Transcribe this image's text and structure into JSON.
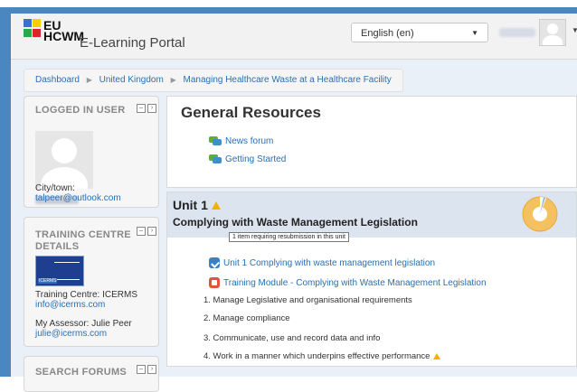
{
  "header": {
    "logo_line1": "EU",
    "logo_line2": "HCWM",
    "portal_name": "E-Learning Portal",
    "language": "English (en)",
    "colors": {
      "frame": "#4a86c0",
      "link": "#2a6fb3",
      "warning": "#f2b300"
    }
  },
  "breadcrumb": [
    "Dashboard",
    "United Kingdom",
    "Managing Healthcare Waste at a Healthcare Facility"
  ],
  "logged_user": {
    "title": "LOGGED IN USER",
    "city_label": "City/town:",
    "email": "talpeer@outlook.com"
  },
  "training_centre": {
    "title_line1": "TRAINING CENTRE",
    "title_line2": "DETAILS",
    "logo_label": "ICERMS",
    "centre": "Training Centre: ICERMS",
    "centre_email": "info@icerms.com",
    "assessor": "My Assessor: Julie Peer",
    "assessor_email": "julie@icerms.com"
  },
  "search_forums": {
    "title": "SEARCH FORUMS"
  },
  "general": {
    "title": "General Resources",
    "items": [
      "News forum",
      "Getting Started"
    ]
  },
  "unit": {
    "title": "Unit 1",
    "subtitle": "Complying with Waste Management Legislation",
    "tooltip": "1 item requiring resubmission in this unit",
    "activities": [
      "Unit 1 Complying with waste management legislation",
      "Training Module - Complying with Waste Management Legislation"
    ],
    "criteria": [
      "1. Manage Legislative and organisational requirements",
      "2. Manage compliance",
      "3. Communicate, use and record data and info",
      "4. Work in a manner which underpins effective performance"
    ]
  }
}
